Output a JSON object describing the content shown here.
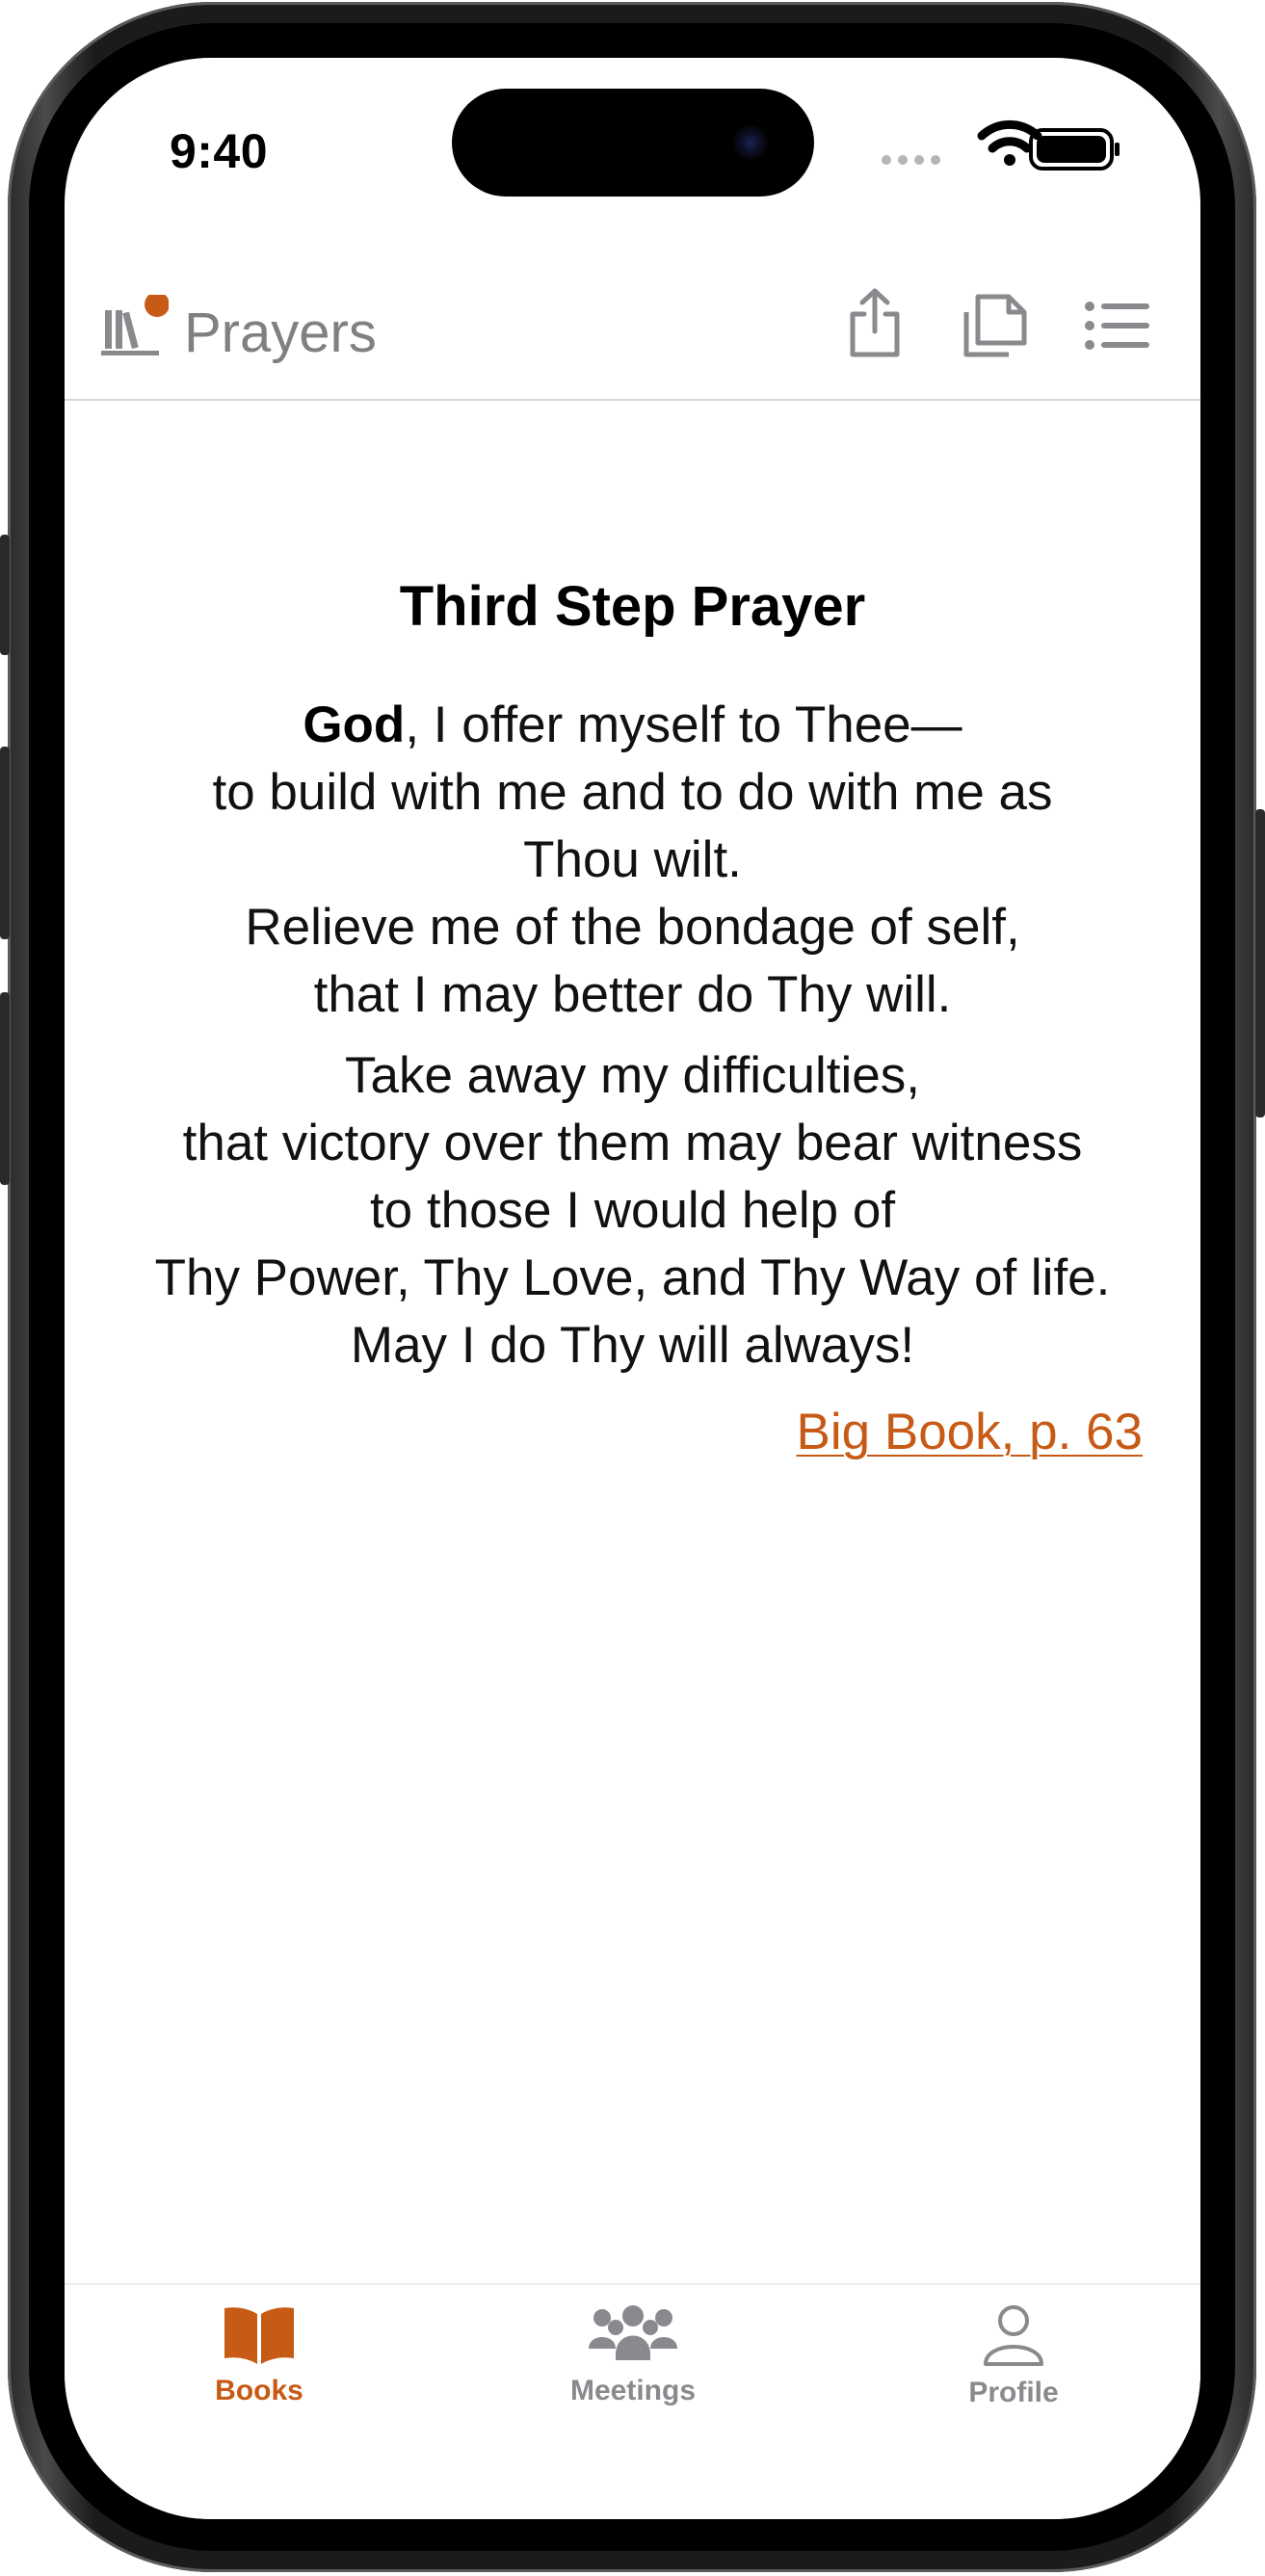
{
  "status_bar": {
    "time": "9:40"
  },
  "navbar": {
    "title": "Prayers",
    "icons": [
      "library-icon",
      "share-icon",
      "copy-icon",
      "list-icon"
    ]
  },
  "prayer": {
    "title": "Third Step Prayer",
    "lead_word": "God",
    "stanza1_line1_rest": ", I offer myself to Thee—",
    "stanza1": [
      "to build with me and to do with me as",
      "Thou wilt.",
      "Relieve me of the bondage of self,",
      "that I may better do Thy will."
    ],
    "stanza2": [
      "Take away my difficulties,",
      "that victory over them may bear witness",
      "to those I would help of",
      "Thy Power, Thy Love, and Thy Way of life.",
      "May I do Thy will always!"
    ],
    "source_link": "Big Book, p. 63"
  },
  "tabbar": {
    "tabs": [
      {
        "label": "Books",
        "icon": "book-icon",
        "active": true
      },
      {
        "label": "Meetings",
        "icon": "people-icon",
        "active": false
      },
      {
        "label": "Profile",
        "icon": "person-icon",
        "active": false
      }
    ]
  },
  "colors": {
    "accent": "#c75a14",
    "inactive": "#8a8a8e",
    "nav_gray": "#808080"
  }
}
